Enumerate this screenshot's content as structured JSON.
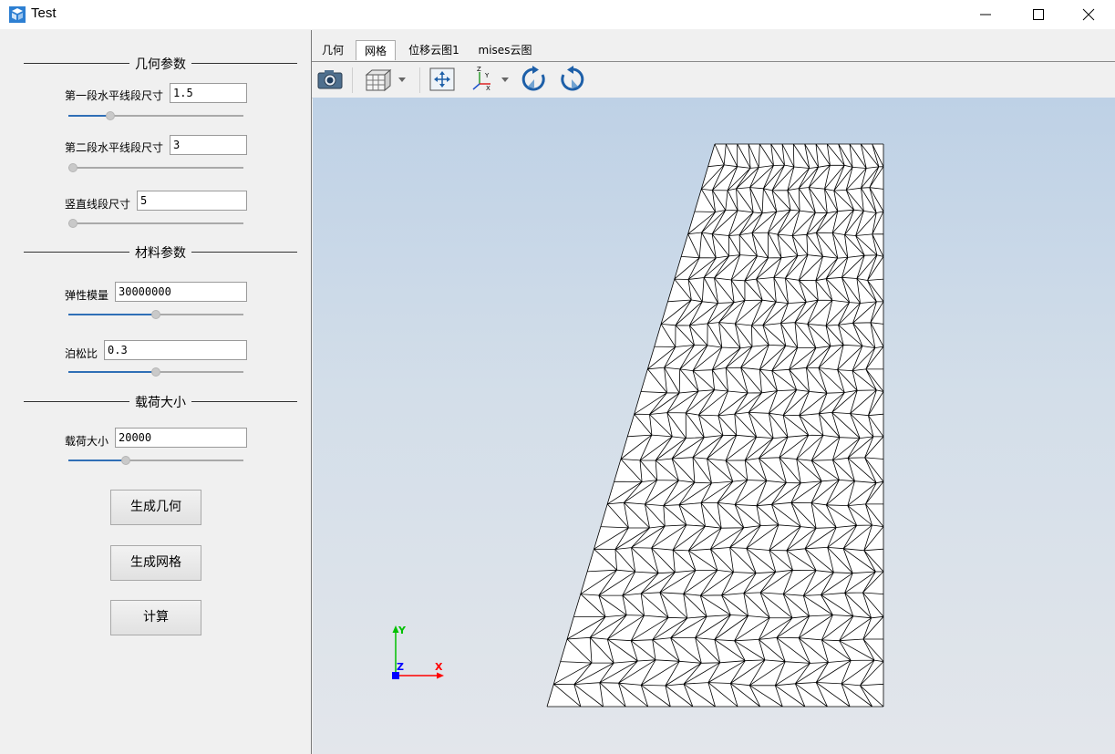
{
  "window": {
    "title": "Test",
    "app_icon": "app-cube-icon",
    "controls": [
      "minimize-icon",
      "maximize-icon",
      "close-icon"
    ]
  },
  "left_panel": {
    "geometry": {
      "heading": "几何参数",
      "fields": [
        {
          "label": "第一段水平线段尺寸",
          "value": "1.5",
          "slider_fraction": 0.24
        },
        {
          "label": "第二段水平线段尺寸",
          "value": "3",
          "slider_fraction": 0.0
        },
        {
          "label": "竖直线段尺寸",
          "value": "5",
          "slider_fraction": 0.0
        }
      ]
    },
    "material": {
      "heading": "材料参数",
      "fields": [
        {
          "label": "弹性模量",
          "value": "30000000",
          "slider_fraction": 0.5
        },
        {
          "label": "泊松比",
          "value": "0.3",
          "slider_fraction": 0.5
        }
      ]
    },
    "load": {
      "heading": "载荷大小",
      "fields": [
        {
          "label": "载荷大小",
          "value": "20000",
          "slider_fraction": 0.33
        }
      ]
    },
    "buttons": {
      "generate_geometry": "生成几何",
      "generate_mesh": "生成网格",
      "compute": "计算"
    }
  },
  "tabs": [
    {
      "label": "几何",
      "active": false
    },
    {
      "label": "网格",
      "active": true
    },
    {
      "label": "位移云图1",
      "active": false
    },
    {
      "label": "mises云图",
      "active": false
    }
  ],
  "toolbar": [
    "camera-icon",
    "view-cube-icon",
    "fit-view-icon",
    "axes-orientation-icon",
    "rotate-cw-icon",
    "rotate-ccw-icon"
  ],
  "axes_triad": {
    "x": "X",
    "y": "Y",
    "z": "Z"
  },
  "colors": {
    "accent": "#2f6fb6",
    "viewport_top": "#bed1e6",
    "viewport_bottom": "#e3e6eb",
    "axis_x": "#ff0000",
    "axis_y": "#00c000",
    "axis_z": "#0000ff"
  }
}
